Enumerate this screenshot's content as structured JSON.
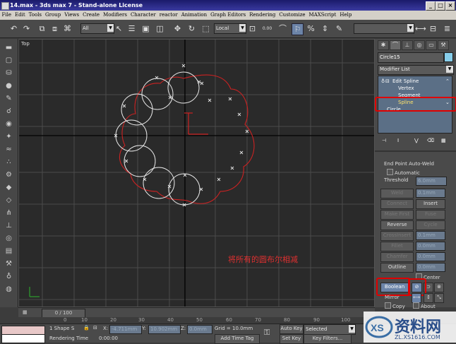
{
  "window": {
    "title": "14.max - 3ds max 7 - Stand-alone License",
    "min": "_",
    "max": "□",
    "close": "×"
  },
  "menu": [
    "File",
    "Edit",
    "Tools",
    "Group",
    "Views",
    "Create",
    "Modifiers",
    "Character",
    "reactor",
    "Animation",
    "Graph Editors",
    "Rendering",
    "Customize",
    "MAXScript",
    "Help"
  ],
  "toolbar": {
    "selection_filter": "All",
    "coord_system": "Local",
    "snap_value": "0.00",
    "dropdown_arrow": "▼"
  },
  "viewport": {
    "label": "Top",
    "annotation": "将所有的圆布尔相减"
  },
  "command_panel": {
    "object_name": "Circle15",
    "object_color": "#87ceeb",
    "modifier_list": "Modifier List",
    "stack": {
      "edit_spline": "Edit Spline",
      "vertex": "Vertex",
      "segment": "Segment",
      "spline": "Spline",
      "circle": "Circle"
    },
    "rollout": {
      "end_point_auto_weld": "End Point Auto-Weld",
      "automatic": "Automatic",
      "threshold_label": "Threshold",
      "threshold_value": "6.0mm",
      "weld": "Weld",
      "weld_value": "0.1mm",
      "connect": "Connect",
      "insert": "Insert",
      "make_first": "Make First",
      "fuse": "Fuse",
      "reverse": "Reverse",
      "cycle": "Cycle",
      "cross_insert": "CrossInsert",
      "cross_insert_value": "0.1mm",
      "fillet": "Fillet",
      "fillet_value": "0.0mm",
      "chamfer": "Chamfer",
      "chamfer_value": "0.0mm",
      "outline": "Outline",
      "outline_value": "0.0mm",
      "center": "Center",
      "boolean": "Boolean",
      "mirror": "Mirror",
      "copy": "Copy",
      "about": "About"
    }
  },
  "timeline": {
    "slider": "0 / 100",
    "ticks": [
      "0",
      "10",
      "20",
      "30",
      "40",
      "50",
      "60",
      "70",
      "80",
      "90",
      "100"
    ]
  },
  "status": {
    "shapes_selected": "1 Shape S",
    "x_label": "X:",
    "x_value": "-4.711mm",
    "y_label": "Y:",
    "y_value": "10.902mm",
    "z_label": "Z:",
    "z_value": "0.0mm",
    "grid": "Grid = 10.0mm",
    "auto_key": "Auto Key",
    "selected": "Selected",
    "set_key": "Set Key",
    "key_filters": "Key Filters...",
    "rendering_time_label": "Rendering Time",
    "rendering_time": "0:00:00",
    "add_time_tag": "Add Time Tag"
  },
  "watermark": {
    "brand": "资料网",
    "url": "ZL.XS1616.COM"
  },
  "colors": {
    "highlight": "#e00000",
    "spline": "#cc2222",
    "circles": "#ffffff",
    "viewport_bg": "#2a2a2a"
  }
}
